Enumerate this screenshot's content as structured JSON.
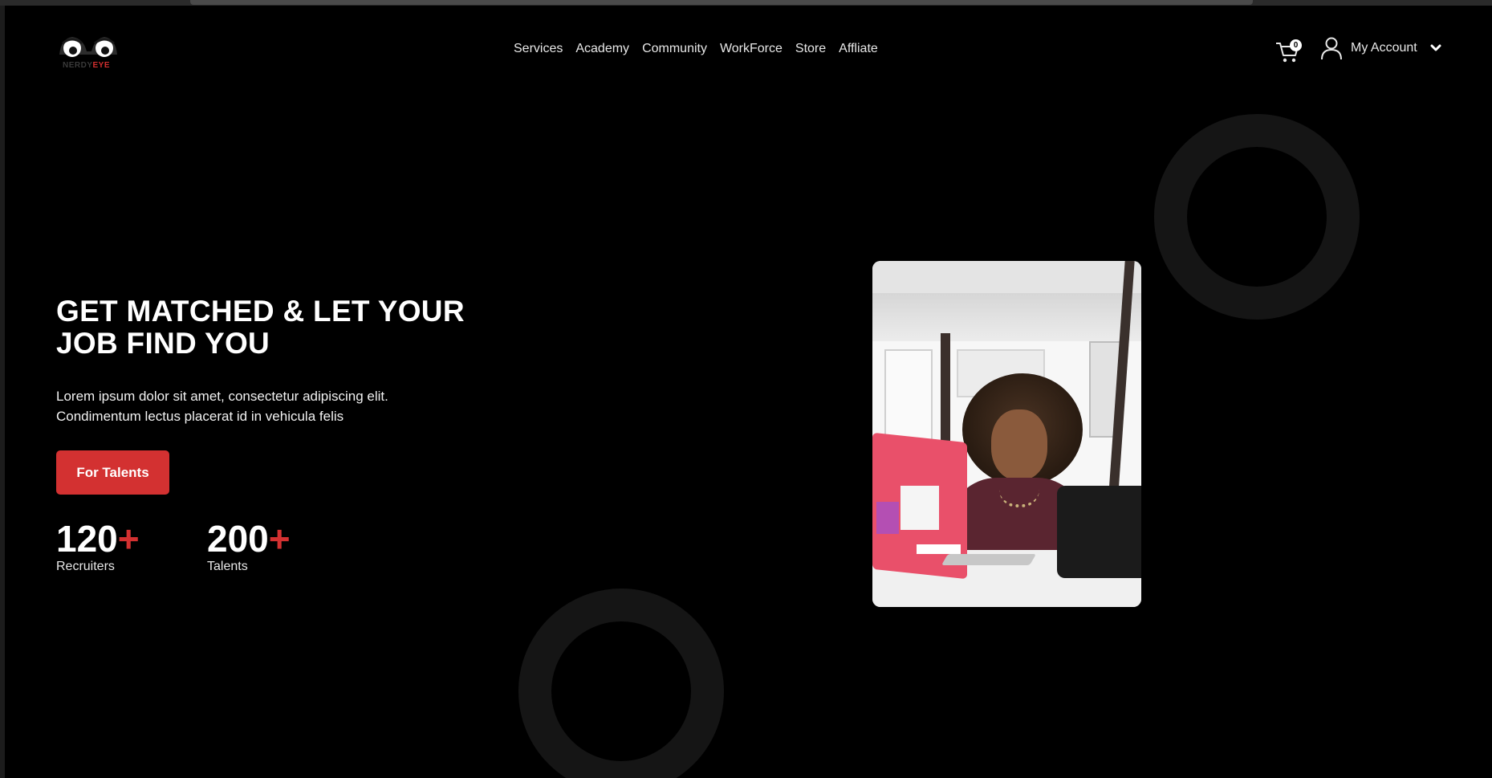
{
  "brand": {
    "logo_word_1": "NERDY",
    "logo_word_2": "EYE"
  },
  "nav": {
    "items": [
      {
        "label": "Services"
      },
      {
        "label": "Academy"
      },
      {
        "label": "Community"
      },
      {
        "label": "WorkForce"
      },
      {
        "label": "Store"
      },
      {
        "label": "Affliate"
      }
    ]
  },
  "header": {
    "cart_icon": "cart-icon",
    "cart_count": "0",
    "account_icon": "user-icon",
    "account_label": "My Account",
    "account_chevron": "chevron-down-icon"
  },
  "hero": {
    "title_line_1": "GET MATCHED & LET YOUR",
    "title_line_2": "JOB FIND YOU",
    "desc_line_1": "Lorem ipsum dolor sit amet, consectetur adipiscing elit.",
    "desc_line_2": "Condimentum lectus placerat id in vehicula felis",
    "cta_label": "For Talents",
    "stats": [
      {
        "number": "120",
        "plus": "+",
        "label": "Recruiters"
      },
      {
        "number": "200",
        "plus": "+",
        "label": "Talents"
      }
    ]
  },
  "colors": {
    "background": "#000000",
    "accent": "#d33131",
    "ring": "#151515",
    "text": "#ffffff"
  }
}
